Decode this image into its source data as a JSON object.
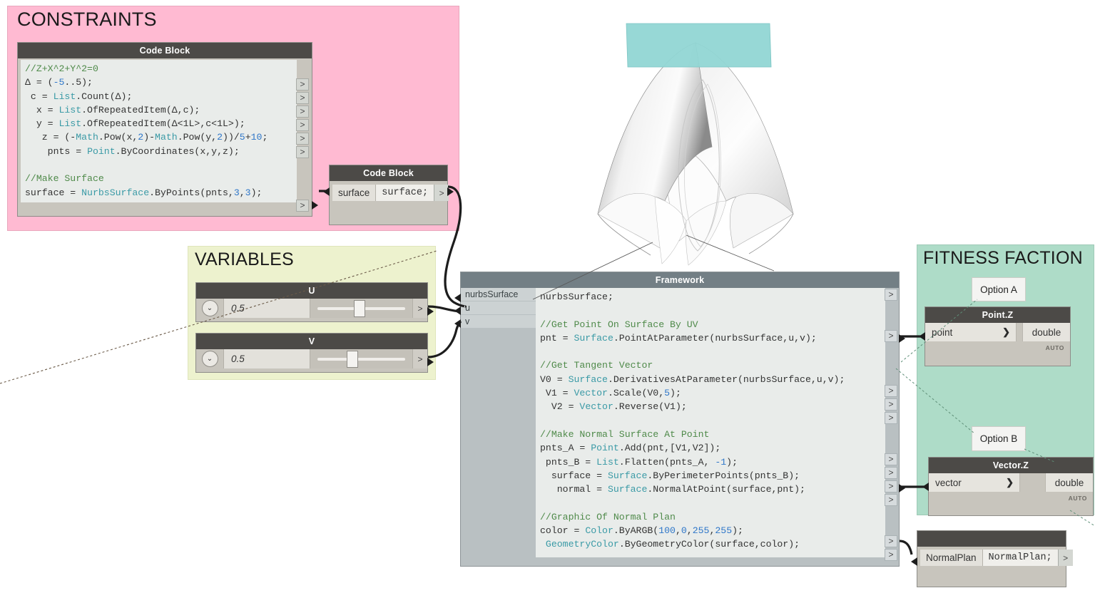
{
  "groups": {
    "constraints": {
      "title": "CONSTRAINTS",
      "color": "#ffbad2"
    },
    "variables": {
      "title": "VARIABLES",
      "color": "#edf2ce"
    },
    "fitness": {
      "title": "FITNESS FACTION",
      "color": "#aedcc8"
    }
  },
  "nodes": {
    "code_block_main": {
      "title": "Code Block",
      "code_lines": [
        "//Z+X^2+Y^2=0",
        "Δ = (-5..5);",
        " c = List.Count(Δ);",
        "  x = List.OfRepeatedItem(Δ,c);",
        "  y = List.OfRepeatedItem(Δ<1L>,c<1L>);",
        "   z = (-Math.Pow(x,2)-Math.Pow(y,2))/5+10;",
        "    pnts = Point.ByCoordinates(x,y,z);",
        "",
        "//Make Surface",
        "surface = NurbsSurface.ByPoints(pnts,3,3);"
      ],
      "port_label": ">"
    },
    "code_block_surface": {
      "title": "Code Block",
      "input_name": "surface",
      "code": "surface;",
      "port_label": ">"
    },
    "slider_u": {
      "title": "U",
      "value": "0.5",
      "caret": "⌄",
      "port_label": ">"
    },
    "slider_v": {
      "title": "V",
      "value": "0.5",
      "caret": "⌄",
      "port_label": ">"
    },
    "framework": {
      "title": "Framework",
      "inputs": [
        "nurbsSurface",
        "u",
        "v"
      ],
      "code_lines": [
        "nurbsSurface;",
        "",
        "//Get Point On Surface By UV",
        "pnt = Surface.PointAtParameter(nurbsSurface,u,v);",
        "",
        "//Get Tangent Vector",
        "V0 = Surface.DerivativesAtParameter(nurbsSurface,u,v);",
        " V1 = Vector.Scale(V0,5);",
        "  V2 = Vector.Reverse(V1);",
        "",
        "//Make Normal Surface At Point",
        "pnts_A = Point.Add(pnt,[V1,V2]);",
        " pnts_B = List.Flatten(pnts_A, -1);",
        "  surface = Surface.ByPerimeterPoints(pnts_B);",
        "   normal = Surface.NormalAtPoint(surface,pnt);",
        "",
        "//Graphic Of Normal Plan",
        "color = Color.ByARGB(100,0,255,255);",
        " GeometryColor.ByGeometryColor(surface,color);"
      ],
      "port_label": ">"
    },
    "point_z": {
      "title": "Point.Z",
      "input_label": "point",
      "output_label": "double",
      "chevron": "❯",
      "auto_label": "AUTO"
    },
    "vector_z": {
      "title": "Vector.Z",
      "input_label": "vector",
      "output_label": "double",
      "chevron": "❯",
      "auto_label": "AUTO"
    },
    "normal_plan": {
      "title": "",
      "input_name": "NormalPlan",
      "code": "NormalPlan;",
      "port_label": ">"
    }
  },
  "callouts": {
    "option_a": "Option A",
    "option_b": "Option B"
  },
  "geometry": {
    "surface_label": "nurbs-surface-preview",
    "plane_color": "#8cd4d2"
  }
}
